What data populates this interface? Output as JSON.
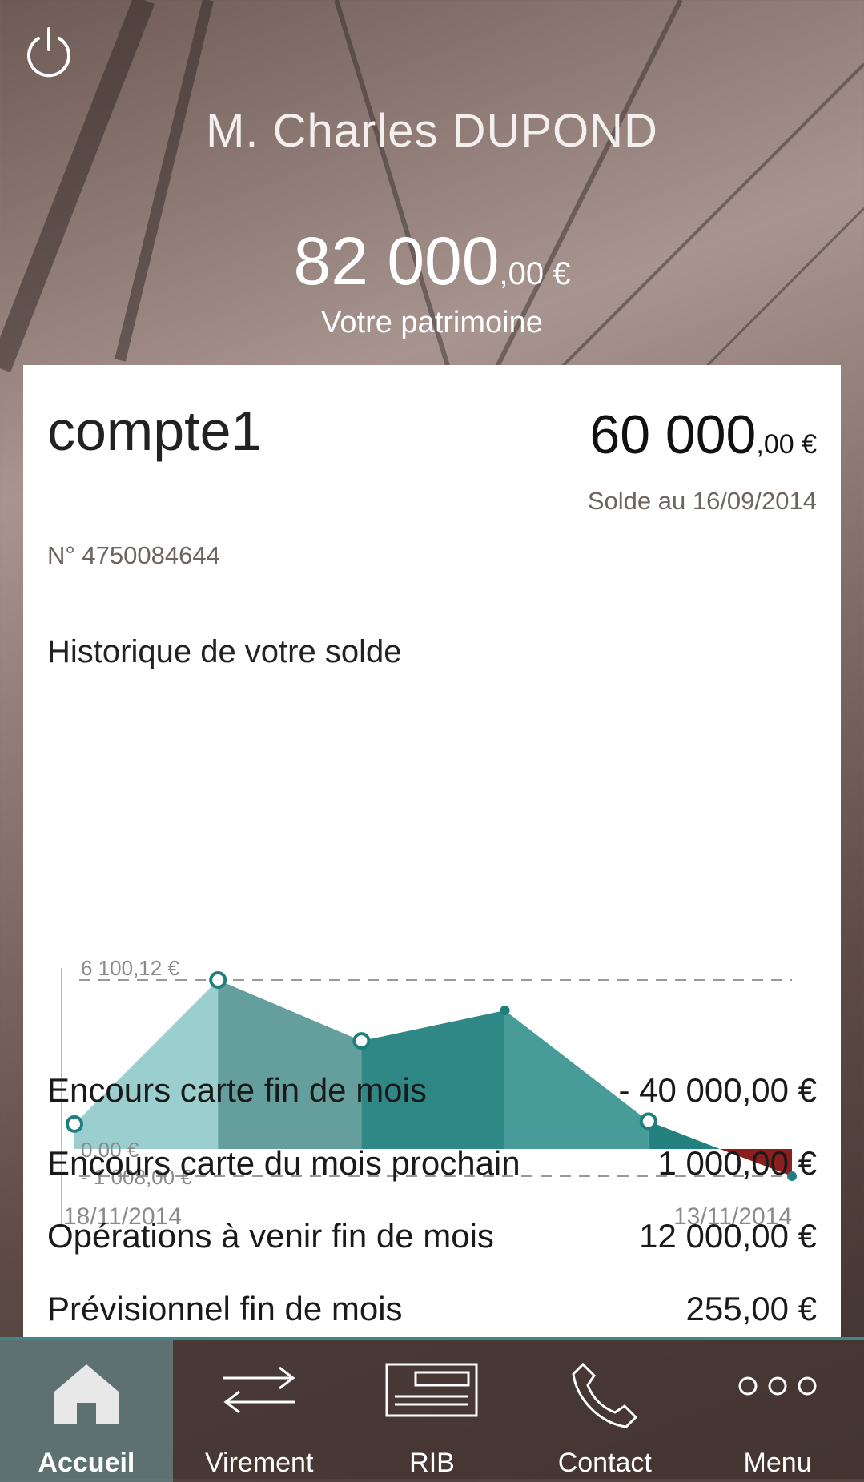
{
  "header": {
    "user_name": "M. Charles DUPOND",
    "patrimoine_int": "82 000",
    "patrimoine_dec": ",00 €",
    "patrimoine_label": "Votre patrimoine"
  },
  "account": {
    "name": "compte1",
    "balance_int": "60 000",
    "balance_dec": ",00 €",
    "solde_label": "Solde au  16/09/2014",
    "number": "N°  4750084644"
  },
  "history": {
    "title": "Historique de votre solde"
  },
  "chart_data": {
    "type": "area",
    "x_start_label": "18/11/2014",
    "x_end_label": "13/11/2014",
    "y_labels": [
      "6 100,12 €",
      "0,00 €",
      "- 1 008,00 €"
    ],
    "ylim": [
      -1008,
      6100.12
    ],
    "values": [
      900,
      6100.12,
      3900,
      5000,
      1000,
      -1008
    ],
    "segment_colors": [
      "#9bcfcf",
      "#649f9e",
      "#2f8886",
      "#479b99",
      "#22807e",
      "#8b1e1e"
    ]
  },
  "summary_rows": [
    {
      "label": "Encours carte fin de mois",
      "value": "- 40 000,00 €"
    },
    {
      "label": "Encours carte du mois prochain",
      "value": "1 000,00 €"
    },
    {
      "label": "Opérations à venir fin de mois",
      "value": "12 000,00 €"
    },
    {
      "label": "Prévisionnel fin de mois",
      "value": "255,00 €"
    }
  ],
  "nav": [
    {
      "label": "Accueil",
      "icon": "home-icon",
      "active": true
    },
    {
      "label": "Virement",
      "icon": "transfer-icon"
    },
    {
      "label": "RIB",
      "icon": "rib-card-icon"
    },
    {
      "label": "Contact",
      "icon": "phone-icon"
    },
    {
      "label": "Menu",
      "icon": "more-dots-icon"
    }
  ]
}
